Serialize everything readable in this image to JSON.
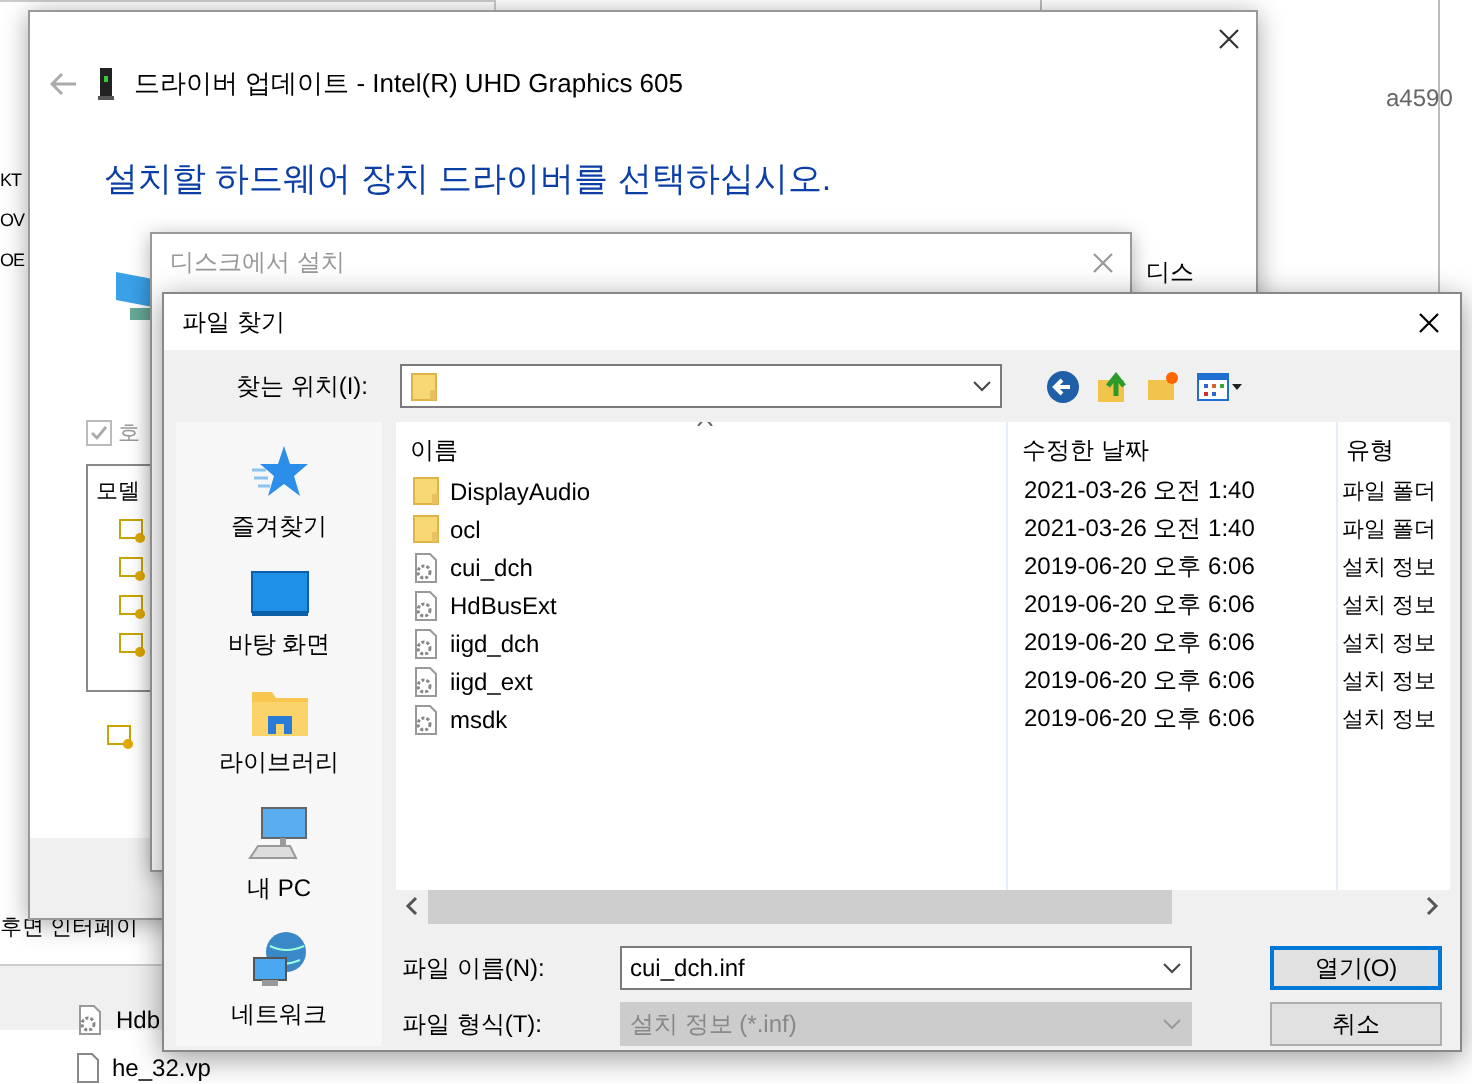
{
  "background": {
    "left_fragments": [
      "KT",
      "OV",
      "OE"
    ],
    "right_fragment": "a4590",
    "bottom_text": "후면 인터페이",
    "files": [
      {
        "name": "Hdb"
      },
      {
        "name": "he_32.vp"
      }
    ]
  },
  "update_window": {
    "title": "드라이버 업데이트 - Intel(R) UHD Graphics 605",
    "heading": "설치할 하드웨어 장치 드라이버를 선택하십시오.",
    "side_label": "디스",
    "checkbox": {
      "label": "호",
      "checked": true
    },
    "list_header": "모델"
  },
  "disk_dialog": {
    "title": "디스크에서 설치"
  },
  "file_dialog": {
    "title": "파일 찾기",
    "look_in_label": "찾는 위치(I):",
    "places": [
      {
        "label": "즐겨찾기",
        "kind": "star"
      },
      {
        "label": "바탕 화면",
        "kind": "desktop"
      },
      {
        "label": "라이브러리",
        "kind": "library"
      },
      {
        "label": "내 PC",
        "kind": "pc"
      },
      {
        "label": "네트워크",
        "kind": "network"
      }
    ],
    "columns": [
      "이름",
      "수정한 날짜",
      "유형"
    ],
    "rows": [
      {
        "name": "DisplayAudio",
        "date": "2021-03-26 오전 1:40",
        "type": "파일 폴더",
        "kind": "folder"
      },
      {
        "name": "ocl",
        "date": "2021-03-26 오전 1:40",
        "type": "파일 폴더",
        "kind": "folder"
      },
      {
        "name": "cui_dch",
        "date": "2019-06-20 오후 6:06",
        "type": "설치 정보",
        "kind": "file"
      },
      {
        "name": "HdBusExt",
        "date": "2019-06-20 오후 6:06",
        "type": "설치 정보",
        "kind": "file"
      },
      {
        "name": "iigd_dch",
        "date": "2019-06-20 오후 6:06",
        "type": "설치 정보",
        "kind": "file"
      },
      {
        "name": "iigd_ext",
        "date": "2019-06-20 오후 6:06",
        "type": "설치 정보",
        "kind": "file"
      },
      {
        "name": "msdk",
        "date": "2019-06-20 오후 6:06",
        "type": "설치 정보",
        "kind": "file"
      }
    ],
    "file_name": {
      "label": "파일 이름(N):",
      "value": "cui_dch.inf"
    },
    "file_type": {
      "label": "파일 형식(T):",
      "value": "설치 정보 (*.inf)",
      "disabled": true
    },
    "buttons": [
      {
        "label": "열기(O)",
        "default": true
      },
      {
        "label": "취소",
        "default": false
      }
    ]
  }
}
